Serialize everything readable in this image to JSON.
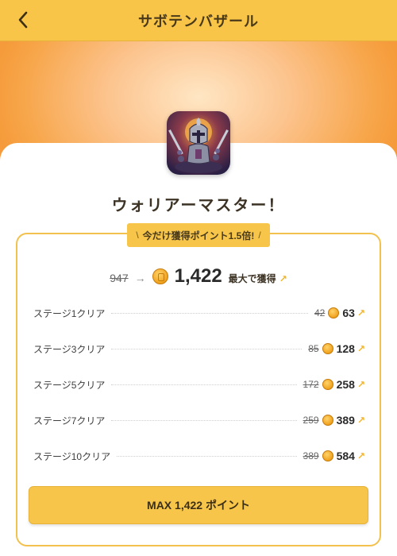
{
  "header": {
    "title": "サボテンバザール",
    "back_icon": "chevron-left-icon"
  },
  "app": {
    "title": "ウォリアーマスター！",
    "icon": "knight-warrior-app-icon"
  },
  "promo": {
    "label": "今だけ獲得ポイント1.5倍!",
    "left_mark": "\\",
    "right_mark": "/"
  },
  "summary": {
    "old_total": "947",
    "new_total": "1,422",
    "suffix": "最大で獲得",
    "arrow_icon": "arrow-right-icon",
    "coin_icon": "coin-icon",
    "up_icon": "arrow-up-right-icon"
  },
  "rows": [
    {
      "label": "ステージ1クリア",
      "old": "42",
      "new": "63"
    },
    {
      "label": "ステージ3クリア",
      "old": "85",
      "new": "128"
    },
    {
      "label": "ステージ5クリア",
      "old": "172",
      "new": "258"
    },
    {
      "label": "ステージ7クリア",
      "old": "259",
      "new": "389"
    },
    {
      "label": "ステージ10クリア",
      "old": "389",
      "new": "584"
    }
  ],
  "button": {
    "label": "MAX 1,422 ポイント"
  },
  "colors": {
    "accent": "#f6c54a",
    "header": "#f8c548",
    "hero_orange": "#f59b3b",
    "up_arrow": "#f2b52b"
  }
}
